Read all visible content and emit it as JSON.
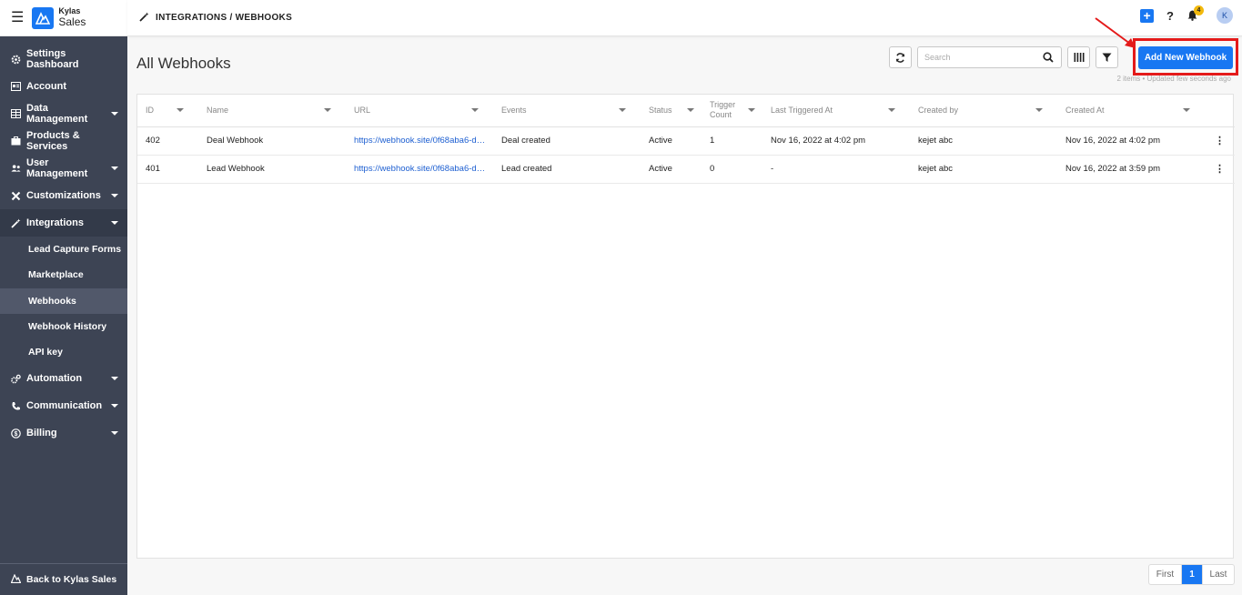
{
  "brand": {
    "top": "Kylas",
    "bottom": "Sales"
  },
  "sidebar": {
    "items": [
      {
        "label": "Settings Dashboard",
        "icon": "gear-icon"
      },
      {
        "label": "Account",
        "icon": "account-icon"
      },
      {
        "label": "Data Management",
        "icon": "table-icon",
        "caret": true
      },
      {
        "label": "Products & Services",
        "icon": "box-icon"
      },
      {
        "label": "User Management",
        "icon": "users-icon",
        "caret": true
      },
      {
        "label": "Customizations",
        "icon": "tools-icon",
        "caret": true
      },
      {
        "label": "Integrations",
        "icon": "magic-wand-icon",
        "caret": true
      }
    ],
    "sub_items": [
      "Lead Capture Forms",
      "Marketplace",
      "Webhooks",
      "Webhook History",
      "API key"
    ],
    "active_sub": "Webhooks",
    "bottom_items": [
      {
        "label": "Automation",
        "icon": "cogs-icon",
        "caret": true
      },
      {
        "label": "Communication",
        "icon": "phone-icon",
        "caret": true
      },
      {
        "label": "Billing",
        "icon": "billing-icon",
        "caret": true
      }
    ],
    "back_label": "Back to Kylas Sales"
  },
  "header": {
    "breadcrumb": "INTEGRATIONS / WEBHOOKS",
    "notification_count": "4",
    "avatar_initial": "K",
    "help": "?"
  },
  "main": {
    "title": "All Webhooks",
    "search_placeholder": "Search",
    "add_button": "Add New Webhook",
    "meta": "2 items • Updated few seconds ago"
  },
  "table": {
    "columns": [
      "ID",
      "Name",
      "URL",
      "Events",
      "Status",
      "Trigger Count",
      "Last Triggered At",
      "Created by",
      "Created At"
    ],
    "rows": [
      [
        "402",
        "Deal Webhook",
        "https://webhook.site/0f68aba6-d…",
        "Deal created",
        "Active",
        "1",
        "Nov 16, 2022 at 4:02 pm",
        "kejet abc",
        "Nov 16, 2022 at 4:02 pm"
      ],
      [
        "401",
        "Lead Webhook",
        "https://webhook.site/0f68aba6-d…",
        "Lead created",
        "Active",
        "0",
        "-",
        "kejet abc",
        "Nov 16, 2022 at 3:59 pm"
      ]
    ]
  },
  "pagination": {
    "first": "First",
    "current": "1",
    "last": "Last"
  },
  "colors": {
    "accent": "#1877f2",
    "sidebar": "#3d4454",
    "highlight": "#e41a1a"
  }
}
